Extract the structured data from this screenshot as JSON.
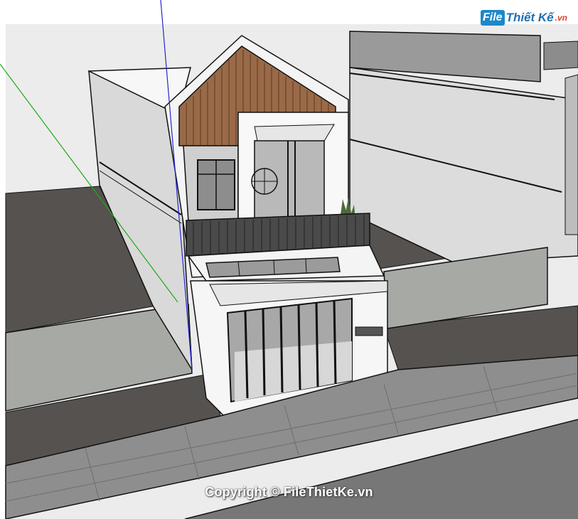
{
  "watermark": {
    "logo_badge": "File",
    "logo_text": "Thiết Kế",
    "logo_tld": ".vn",
    "copyright": "Copyright © FileThietKe.vn"
  },
  "colors": {
    "sky": "#ececec",
    "ground": "#56524f",
    "walls": "#d9d9d9",
    "white_wall": "#f4f4f4",
    "wood": "#9a6a48",
    "concrete": "#a7a9a5",
    "sidewalk": "#8e8e8e",
    "road": "#777777",
    "glass": "#c6c6c6",
    "dark_glass": "#707070",
    "axis_blue": "#2424d6",
    "axis_green": "#1ea81e",
    "logo_blue": "#1e88c8",
    "logo_red": "#e33b2e"
  }
}
